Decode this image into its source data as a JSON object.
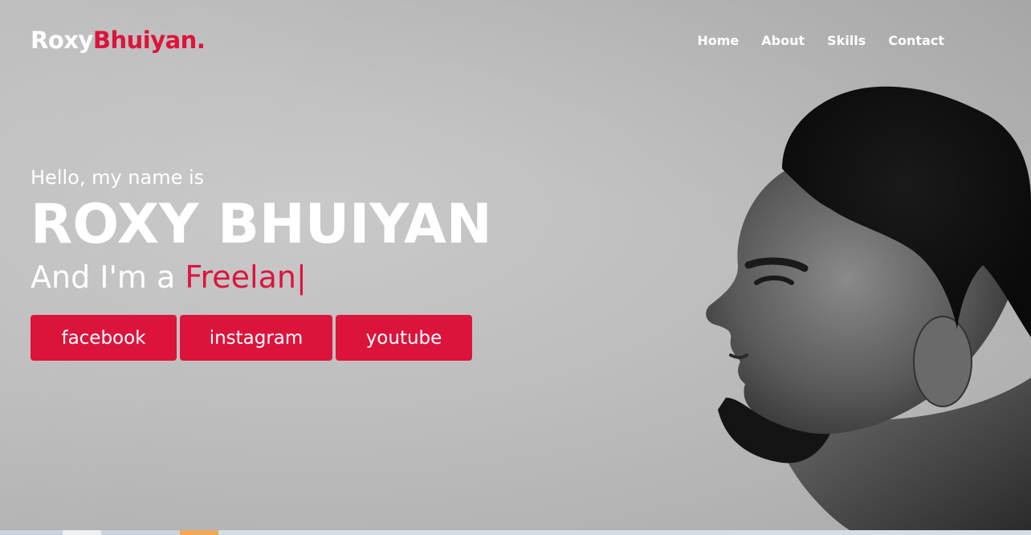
{
  "theme": {
    "accent": "#dc143c",
    "text": "#ffffff",
    "background": "#bfbfbf"
  },
  "header": {
    "logo_primary": "Roxy",
    "logo_accent": "Bhuiyan."
  },
  "nav": {
    "items": [
      {
        "label": "Home"
      },
      {
        "label": "About"
      },
      {
        "label": "Skills"
      },
      {
        "label": "Contact"
      }
    ]
  },
  "hero": {
    "greeting": "Hello, my name is",
    "name": "ROXY BHUIYAN",
    "role_prefix": "And I'm a ",
    "role_typed": "Freelan",
    "cursor": "|"
  },
  "socials": {
    "items": [
      {
        "label": "facebook",
        "icon": "facebook-link"
      },
      {
        "label": "instagram",
        "icon": "instagram-link"
      },
      {
        "label": "youtube",
        "icon": "youtube-link"
      }
    ]
  }
}
